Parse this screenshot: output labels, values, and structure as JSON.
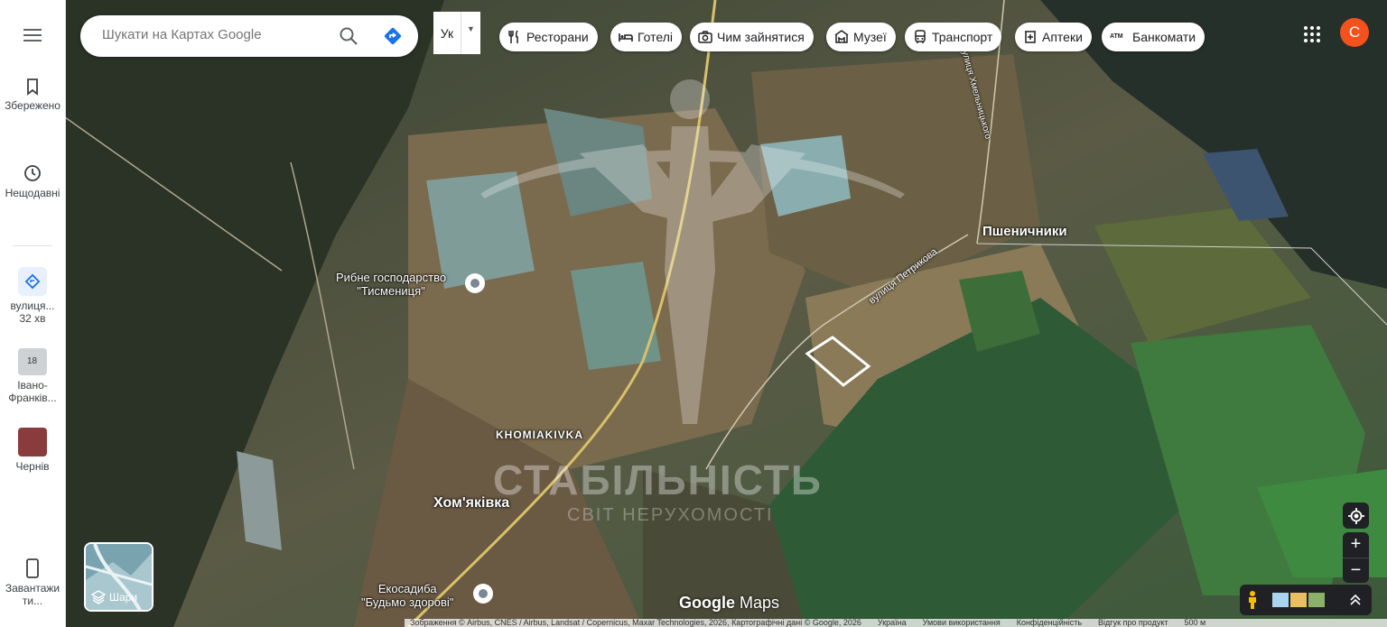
{
  "search": {
    "placeholder": "Шукати на Картах Google"
  },
  "language": {
    "code": "Ук"
  },
  "chips": [
    {
      "label": "Ресторани",
      "icon": "fork-knife-icon"
    },
    {
      "label": "Готелі",
      "icon": "bed-icon"
    },
    {
      "label": "Чим зайнятися",
      "icon": "camera-icon"
    },
    {
      "label": "Музеї",
      "icon": "museum-icon"
    },
    {
      "label": "Транспорт",
      "icon": "bus-icon"
    },
    {
      "label": "Аптеки",
      "icon": "pharmacy-icon"
    },
    {
      "label": "Банкомати",
      "icon": "atm-icon"
    }
  ],
  "atm_badge": "ATM",
  "user": {
    "initial": "C",
    "color": "#f4511e"
  },
  "rail": {
    "saved": "Збережено",
    "recent": "Нещодавні",
    "items": [
      {
        "label": "вулиця...",
        "sub": "32 хв"
      },
      {
        "label": "Івано-Франків...",
        "badge": "18"
      },
      {
        "label": "Чернів"
      }
    ],
    "download": "Завантажити..."
  },
  "map_labels": {
    "pshenychnyky": "Пшеничники",
    "khomiakivka_en": "KHOMIAKIVKA",
    "khomiakivka": "Хом'яківка",
    "street_petrykova": "вулиця Петрикова",
    "street_khmelnytskoho": "вулиця Хмельницького",
    "fish_farm": "Рибне господарство\n\"Тисмениця\"",
    "ecofarm": "Екосадиба\n\"Будьмо здорові\""
  },
  "watermark": {
    "title": "СТАБІЛЬНІСТЬ",
    "subtitle": "СВІТ НЕРУХОМОСТІ"
  },
  "layers": {
    "label": "Шари"
  },
  "logo": {
    "google": "Google",
    "maps": "Maps"
  },
  "footer": {
    "credits": "Зображення © Airbus, CNES / Airbus, Landsat / Copernicus, Maxar Technologies, 2026, Картографічні дані © Google, 2026",
    "country": "Україна",
    "terms": "Умови використання",
    "privacy": "Конфіденційність",
    "feedback": "Відгук про продукт",
    "scale": "500 м"
  },
  "colors": {
    "accent": "#1a73e8",
    "directions": "#0b8043"
  }
}
